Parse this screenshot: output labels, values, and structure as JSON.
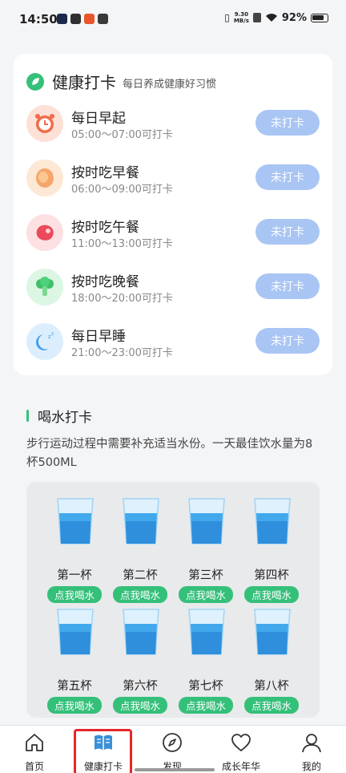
{
  "status_bar": {
    "time": "14:50",
    "network_speed_value": "9.30",
    "network_speed_unit": "MB/s",
    "battery": "92%"
  },
  "health": {
    "title": "健康打卡",
    "subtitle": "每日养成健康好习惯",
    "tasks": [
      {
        "name": "每日早起",
        "time": "05:00～07:00可打卡",
        "button": "未打卡",
        "icon": "alarm-clock-icon",
        "bg": "#fde0d6"
      },
      {
        "name": "按时吃早餐",
        "time": "06:00～09:00可打卡",
        "button": "未打卡",
        "icon": "egg-icon",
        "bg": "#fde8d6"
      },
      {
        "name": "按时吃午餐",
        "time": "11:00～13:00可打卡",
        "button": "未打卡",
        "icon": "steak-icon",
        "bg": "#fde0e2"
      },
      {
        "name": "按时吃晚餐",
        "time": "18:00～20:00可打卡",
        "button": "未打卡",
        "icon": "broccoli-icon",
        "bg": "#dcf6e4"
      },
      {
        "name": "每日早睡",
        "time": "21:00～23:00可打卡",
        "button": "未打卡",
        "icon": "moon-sleep-icon",
        "bg": "#dceefd"
      }
    ]
  },
  "water": {
    "title": "喝水打卡",
    "description": "步行运动过程中需要补充适当水份。一天最佳饮水量为8杯500ML",
    "cups": [
      {
        "label": "第一杯",
        "button": "点我喝水"
      },
      {
        "label": "第二杯",
        "button": "点我喝水"
      },
      {
        "label": "第三杯",
        "button": "点我喝水"
      },
      {
        "label": "第四杯",
        "button": "点我喝水"
      },
      {
        "label": "第五杯",
        "button": "点我喝水"
      },
      {
        "label": "第六杯",
        "button": "点我喝水"
      },
      {
        "label": "第七杯",
        "button": "点我喝水"
      },
      {
        "label": "第八杯",
        "button": "点我喝水"
      }
    ]
  },
  "nav": {
    "items": [
      {
        "label": "首页",
        "icon": "home-icon"
      },
      {
        "label": "健康打卡",
        "icon": "book-icon"
      },
      {
        "label": "发现",
        "icon": "compass-icon"
      },
      {
        "label": "成长年华",
        "icon": "heart-icon"
      },
      {
        "label": "我的",
        "icon": "user-icon"
      }
    ],
    "active_index": 1
  },
  "colors": {
    "accent_green": "#35c07a",
    "button_blue": "#a9c5f4",
    "active_highlight": "#e5262a"
  }
}
